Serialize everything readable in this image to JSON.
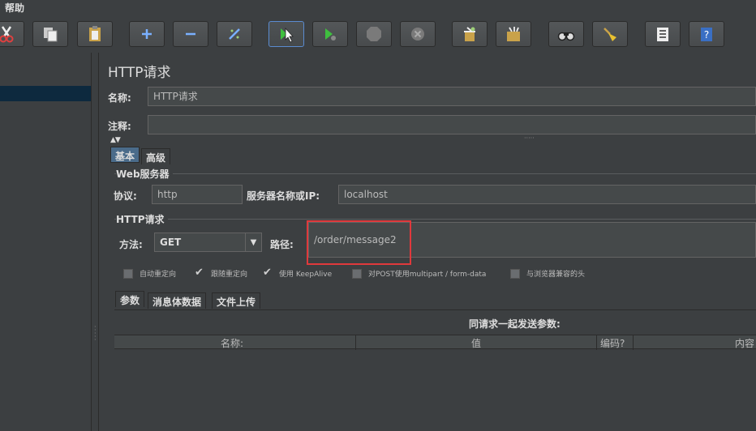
{
  "menubar": {
    "help": "帮助"
  },
  "toolbar": {
    "buttons": [
      {
        "icon": "cut-icon"
      },
      {
        "icon": "copy-icon"
      },
      {
        "icon": "paste-icon"
      },
      {
        "icon": "plus-icon"
      },
      {
        "icon": "minus-icon"
      },
      {
        "icon": "toggle-wand-icon"
      },
      {
        "icon": "start-icon"
      },
      {
        "icon": "start-no-pause-icon"
      },
      {
        "icon": "stop-icon"
      },
      {
        "icon": "shutdown-icon"
      },
      {
        "icon": "clear-icon"
      },
      {
        "icon": "clear-all-icon"
      },
      {
        "icon": "search-binoculars-icon"
      },
      {
        "icon": "reset-broom-icon"
      },
      {
        "icon": "function-helper-icon"
      },
      {
        "icon": "help-icon"
      }
    ]
  },
  "panel": {
    "title": "HTTP请求",
    "name_label": "名称:",
    "name_value": "HTTP请求",
    "comment_label": "注释:",
    "comment_value": "",
    "collapse_glyph": "▲▼",
    "tabs": {
      "basic": "基本",
      "advanced": "高级"
    }
  },
  "web_server": {
    "group_title": "Web服务器",
    "protocol_label": "协议:",
    "protocol_value": "http",
    "server_label": "服务器名称或IP:",
    "server_value": "localhost"
  },
  "http_request": {
    "group_title": "HTTP请求",
    "method_label": "方法:",
    "method_value": "GET",
    "path_label": "路径:",
    "path_value": "/order/message2"
  },
  "options": [
    {
      "label": "自动重定向",
      "checked": false
    },
    {
      "label": "跟随重定向",
      "checked": true
    },
    {
      "label": "使用 KeepAlive",
      "checked": true
    },
    {
      "label": "对POST使用multipart / form-data",
      "checked": false
    },
    {
      "label": "与浏览器兼容的头",
      "checked": false
    }
  ],
  "sub_tabs": {
    "params": "参数",
    "body": "消息体数据",
    "files": "文件上传"
  },
  "params_table": {
    "caption": "同请求一起发送参数:",
    "columns": [
      "名称:",
      "值",
      "编码?",
      "内容"
    ]
  },
  "colors": {
    "accent": "#4a6b8a",
    "highlight": "#e0393c",
    "background": "#3c3f41"
  }
}
